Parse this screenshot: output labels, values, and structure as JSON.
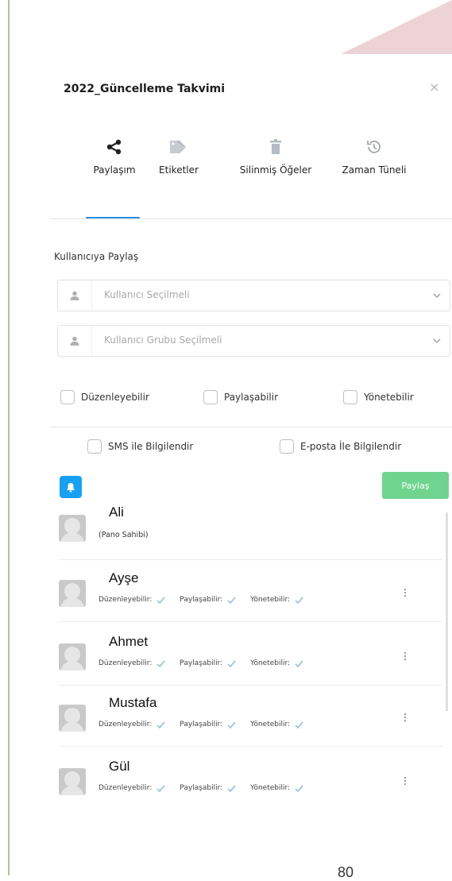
{
  "dialog": {
    "title": "2022_Güncelleme Takvimi",
    "close_symbol": "×"
  },
  "tabs": [
    {
      "label": "Paylaşım",
      "icon": "share-icon",
      "active": true
    },
    {
      "label": "Etiketler",
      "icon": "tag-icon",
      "active": false
    },
    {
      "label": "Silinmiş Öğeler",
      "icon": "trash-icon",
      "active": false
    },
    {
      "label": "Zaman Tüneli",
      "icon": "history-icon",
      "active": false
    }
  ],
  "share": {
    "section_label": "Kullanıcıya Paylaş",
    "user_select_placeholder": "Kullanıcı Seçilmeli",
    "group_select_placeholder": "Kullanıcı Grubu Seçilmeli",
    "permissions": [
      "Düzenleyebilir",
      "Paylaşabilir",
      "Yönetebilir"
    ],
    "notify": [
      "SMS ile Bilgilendir",
      "E-posta İle Bilgilendir"
    ],
    "share_button": "Paylaş"
  },
  "users": {
    "owner": {
      "name": "Ali",
      "note": "(Pano Sahibi)"
    },
    "perm_labels": [
      "Düzenleyebilir:",
      "Paylaşabilir:",
      "Yönetebilir:"
    ],
    "list": [
      {
        "name": "Ayşe"
      },
      {
        "name": "Ahmet"
      },
      {
        "name": "Mustafa"
      },
      {
        "name": "Gül"
      }
    ]
  },
  "page_number": "80",
  "colors": {
    "accent": "#2a8fe0",
    "bell": "#18a0f4",
    "share_button": "#6fd48e",
    "check": "#8bbbe8"
  }
}
